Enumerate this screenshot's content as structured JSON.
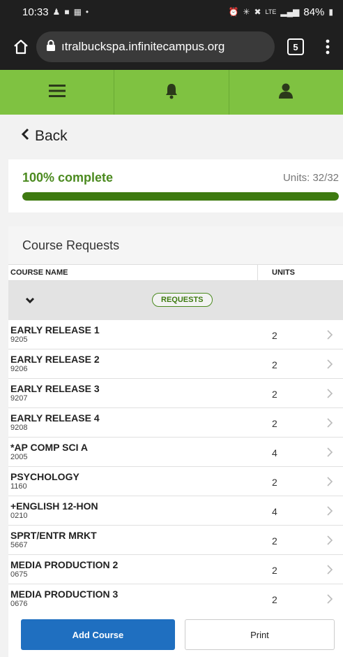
{
  "status_bar": {
    "time": "10:33",
    "battery": "84%",
    "left_icons": [
      "notification-icon",
      "message-icon",
      "app-icon",
      "dot-icon"
    ],
    "right_icons": [
      "alarm-icon",
      "bluetooth-icon",
      "mute-icon",
      "lte-icon",
      "signal-icon",
      "battery-icon"
    ]
  },
  "browser": {
    "url": "ıtralbuckspa.infinitecampus.org",
    "tab_count": "5"
  },
  "app_nav": {
    "items": [
      "menu-icon",
      "bell-icon",
      "user-icon"
    ],
    "color": "#7fc241"
  },
  "back_label": "Back",
  "progress": {
    "label": "100% complete",
    "units_label": "Units: 32/32",
    "fraction": 1.0,
    "fill_color": "#3e7a10"
  },
  "section_title": "Course Requests",
  "table": {
    "headers": {
      "name": "COURSE NAME",
      "units": "UNITS"
    },
    "group_badge": "REQUESTS",
    "rows": [
      {
        "name": "EARLY RELEASE 1",
        "code": "9205",
        "units": "2"
      },
      {
        "name": "EARLY RELEASE 2",
        "code": "9206",
        "units": "2"
      },
      {
        "name": "EARLY RELEASE 3",
        "code": "9207",
        "units": "2"
      },
      {
        "name": "EARLY RELEASE 4",
        "code": "9208",
        "units": "2"
      },
      {
        "name": "*AP COMP SCI A",
        "code": "2005",
        "units": "4"
      },
      {
        "name": "PSYCHOLOGY",
        "code": "1160",
        "units": "2"
      },
      {
        "name": "+ENGLISH 12-HON",
        "code": "0210",
        "units": "4"
      },
      {
        "name": "SPRT/ENTR MRKT",
        "code": "5667",
        "units": "2"
      },
      {
        "name": "MEDIA PRODUCTION 2",
        "code": "0675",
        "units": "2"
      },
      {
        "name": "MEDIA PRODUCTION 3",
        "code": "0676",
        "units": "2"
      }
    ]
  },
  "buttons": {
    "add_course": "Add Course",
    "print": "Print"
  }
}
